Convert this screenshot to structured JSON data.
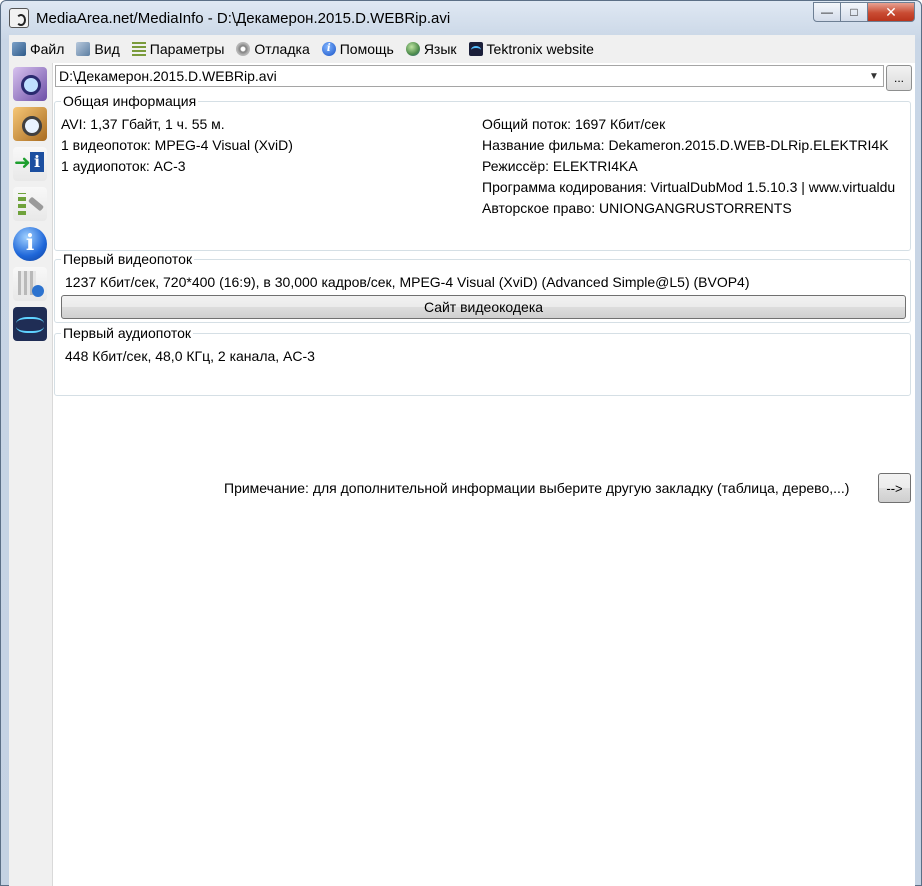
{
  "window": {
    "title": "MediaArea.net/MediaInfo - D:\\Декамерон.2015.D.WEBRip.avi",
    "buttons": {
      "minimize": "—",
      "maximize": "□",
      "close": "✕"
    }
  },
  "menu": [
    {
      "label": "Файл",
      "icon": "file-icon"
    },
    {
      "label": "Вид",
      "icon": "view-icon"
    },
    {
      "label": "Параметры",
      "icon": "params-icon"
    },
    {
      "label": "Отладка",
      "icon": "debug-icon"
    },
    {
      "label": "Помощь",
      "icon": "help-icon"
    },
    {
      "label": "Язык",
      "icon": "language-icon"
    },
    {
      "label": "Tektronix website",
      "icon": "tektronix-icon"
    }
  ],
  "toolbar": [
    "open-file-icon",
    "open-folder-icon",
    "export-icon",
    "options-icon",
    "about-icon",
    "sheet-icon",
    "tektronix-icon"
  ],
  "file": {
    "path": "D:\\Декамерон.2015.D.WEBRip.avi",
    "browse_label": "...",
    "dropdown_glyph": "▼"
  },
  "general": {
    "title": "Общая информация",
    "left": [
      "AVI: 1,37 Гбайт, 1 ч. 55 м.",
      "1 видеопоток: MPEG-4 Visual (XviD)",
      "1 аудиопоток: AC-3"
    ],
    "right": [
      "Общий поток: 1697 Кбит/сек",
      "Название фильма: Dekameron.2015.D.WEB-DLRip.ELEKTRI4K",
      "Режиссёр: ELEKTRI4KA",
      "Программа кодирования: VirtualDubMod 1.5.10.3 | www.virtualdu",
      "Авторское право: UNIONGANGRUSTORRENTS"
    ]
  },
  "video": {
    "title": "Первый видеопоток",
    "info": "1237 Кбит/сек, 720*400 (16:9), в 30,000 кадров/сек, MPEG-4 Visual (XviD) (Advanced Simple@L5) (BVOP4)",
    "button": "Сайт видеокодека"
  },
  "audio": {
    "title": "Первый аудиопоток",
    "info": "448 Кбит/сек, 48,0 КГц, 2 канала, AC-3"
  },
  "note": {
    "text": "Примечание: для дополнительной информации выберите другую закладку (таблица, дерево,...)",
    "button": "-->"
  }
}
